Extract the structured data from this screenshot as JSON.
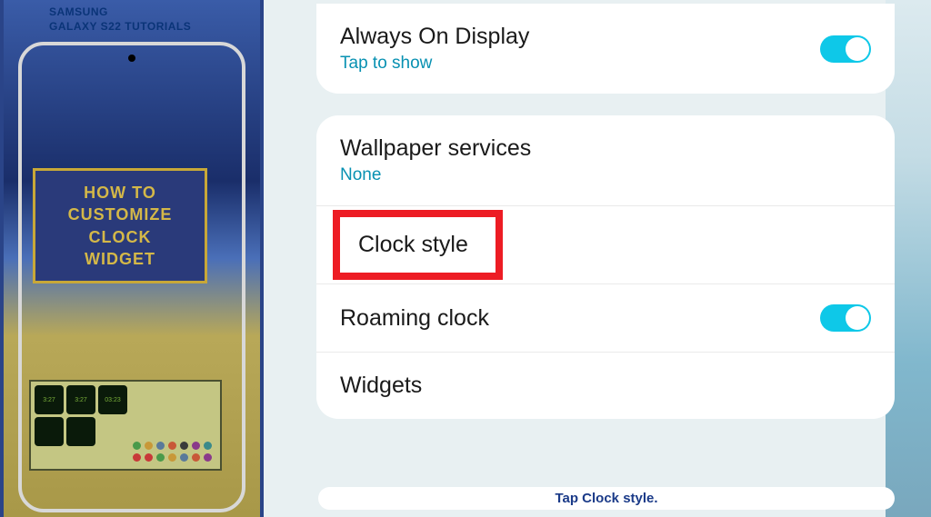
{
  "tutorial": {
    "brand_line1": "SAMSUNG",
    "brand_line2": "GALAXY S22 TUTORIALS",
    "title_l1": "HOW TO",
    "title_l2": "CUSTOMIZE",
    "title_l3": "CLOCK",
    "title_l4": "WIDGET"
  },
  "settings": {
    "aod": {
      "title": "Always On Display",
      "sub": "Tap to show"
    },
    "wallpaper": {
      "title": "Wallpaper services",
      "sub": "None"
    },
    "clock_style": {
      "title": "Clock style"
    },
    "roaming": {
      "title": "Roaming clock"
    },
    "widgets": {
      "title": "Widgets"
    }
  },
  "caption": "Tap Clock style.",
  "colors": [
    "#4a9a4a",
    "#c89838",
    "#5a7a9a",
    "#c85838",
    "#3a3a3a",
    "#8a3a8a",
    "#3a8a8a",
    "#c83838",
    "#c83838",
    "#4a9a4a",
    "#c89838",
    "#5a7a9a",
    "#c85838",
    "#8a3a8a",
    "#3a8a8a"
  ]
}
